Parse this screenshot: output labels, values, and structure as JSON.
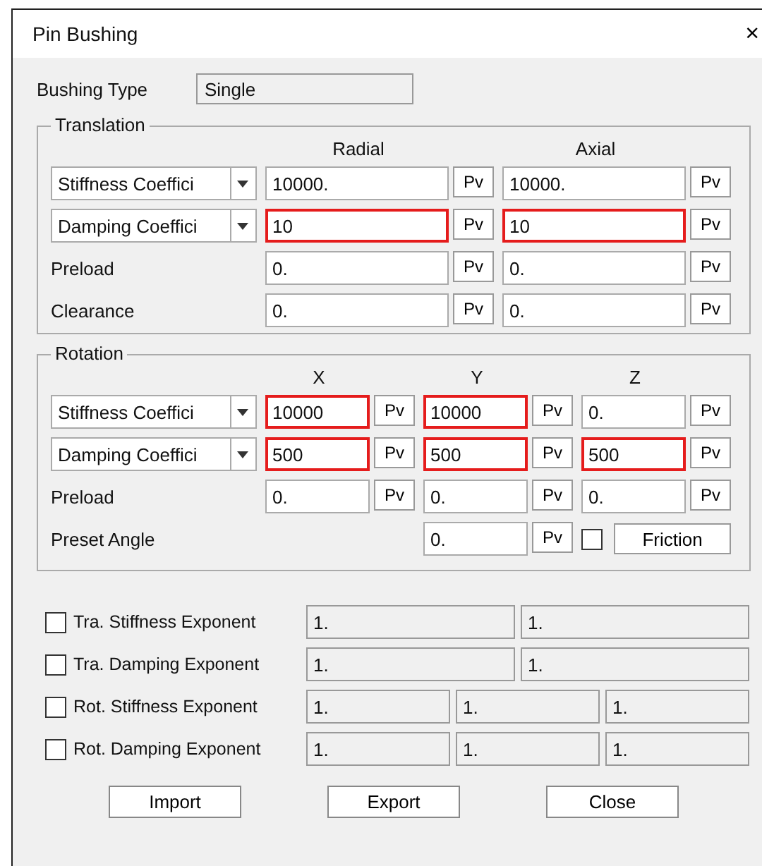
{
  "window": {
    "title": "Pin Bushing",
    "close": "×"
  },
  "bushing_type": {
    "label": "Bushing Type",
    "value": "Single"
  },
  "translation": {
    "title": "Translation",
    "columns": [
      "Radial",
      "Axial"
    ],
    "rows": [
      {
        "kind": "dropdown",
        "label": "Stiffness Coeffici",
        "fields": [
          {
            "value": "10000.",
            "highlighted": false,
            "button": "Pv"
          },
          {
            "value": "10000.",
            "highlighted": false,
            "button": "Pv"
          }
        ]
      },
      {
        "kind": "dropdown",
        "label": "Damping Coeffici",
        "fields": [
          {
            "value": "10",
            "highlighted": true,
            "button": "Pv"
          },
          {
            "value": "10",
            "highlighted": true,
            "button": "Pv"
          }
        ]
      },
      {
        "kind": "label",
        "label": "Preload",
        "fields": [
          {
            "value": "0.",
            "highlighted": false,
            "button": "Pv"
          },
          {
            "value": "0.",
            "highlighted": false,
            "button": "Pv"
          }
        ]
      },
      {
        "kind": "label",
        "label": "Clearance",
        "fields": [
          {
            "value": "0.",
            "highlighted": false,
            "button": "Pv"
          },
          {
            "value": "0.",
            "highlighted": false,
            "button": "Pv"
          }
        ]
      }
    ]
  },
  "rotation": {
    "title": "Rotation",
    "columns": [
      "X",
      "Y",
      "Z"
    ],
    "rows": [
      {
        "kind": "dropdown",
        "label": "Stiffness Coeffici",
        "fields": [
          {
            "value": "10000",
            "highlighted": true,
            "button": "Pv"
          },
          {
            "value": "10000",
            "highlighted": true,
            "button": "Pv"
          },
          {
            "value": "0.",
            "highlighted": false,
            "button": "Pv"
          }
        ]
      },
      {
        "kind": "dropdown",
        "label": "Damping Coeffici",
        "fields": [
          {
            "value": "500",
            "highlighted": true,
            "button": "Pv"
          },
          {
            "value": "500",
            "highlighted": true,
            "button": "Pv"
          },
          {
            "value": "500",
            "highlighted": true,
            "button": "Pv"
          }
        ]
      },
      {
        "kind": "label",
        "label": "Preload",
        "fields": [
          {
            "value": "0.",
            "highlighted": false,
            "button": "Pv"
          },
          {
            "value": "0.",
            "highlighted": false,
            "button": "Pv"
          },
          {
            "value": "0.",
            "highlighted": false,
            "button": "Pv"
          }
        ]
      },
      {
        "kind": "preset",
        "label": "Preset Angle",
        "fields": [
          {
            "value": "0.",
            "highlighted": false,
            "button": "Pv"
          }
        ],
        "checked": false,
        "button": "Friction"
      }
    ]
  },
  "exponents": [
    {
      "label": "Tra. Stiffness Exponent",
      "checked": false,
      "disabled": true,
      "values": [
        "1.",
        "1."
      ]
    },
    {
      "label": "Tra. Damping Exponent",
      "checked": false,
      "disabled": true,
      "values": [
        "1.",
        "1."
      ]
    },
    {
      "label": "Rot. Stiffness Exponent",
      "checked": false,
      "disabled": true,
      "values": [
        "1.",
        "1.",
        "1."
      ]
    },
    {
      "label": "Rot. Damping Exponent",
      "checked": false,
      "disabled": true,
      "values": [
        "1.",
        "1.",
        "1."
      ]
    }
  ],
  "buttons": [
    "Import",
    "Export",
    "Close"
  ]
}
